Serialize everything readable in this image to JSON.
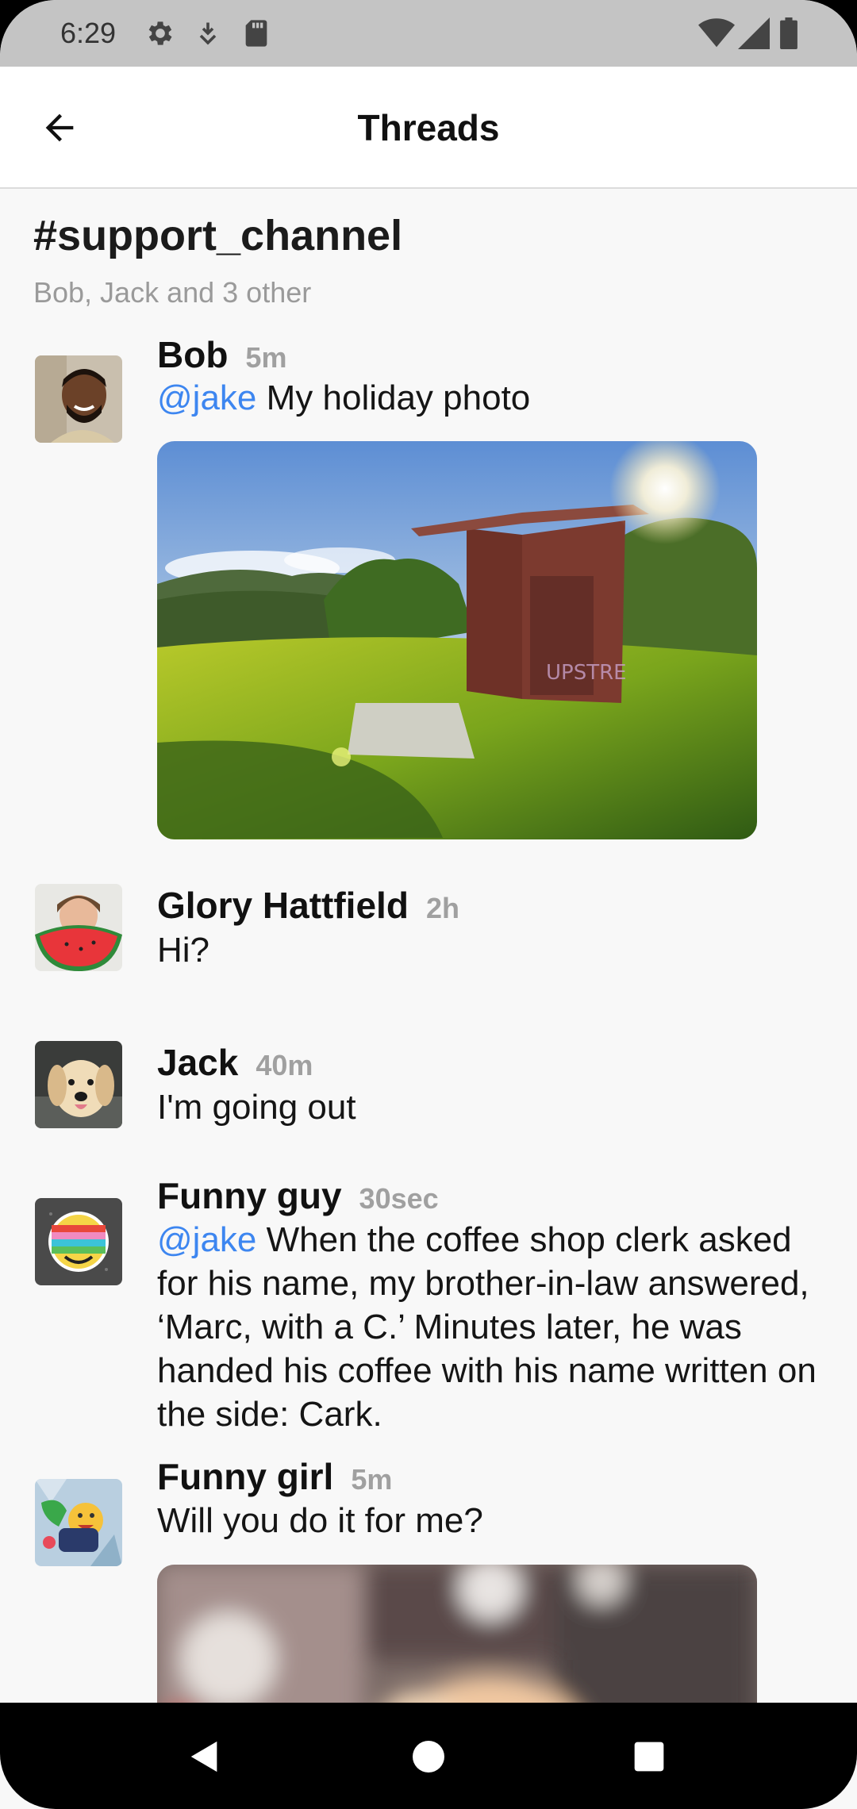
{
  "status_bar": {
    "time": "6:29",
    "icons": [
      "settings-icon",
      "download-icon",
      "sd-card-icon",
      "wifi-icon",
      "signal-icon",
      "battery-icon"
    ]
  },
  "app_bar": {
    "title": "Threads",
    "back_icon": "arrow-back-icon"
  },
  "channel": {
    "name": "#support_channel",
    "members": "Bob, Jack and 3 other"
  },
  "messages": [
    {
      "author": "Bob",
      "time": "5m",
      "mention": "@jake",
      "text": "My holiday photo",
      "has_image": true
    },
    {
      "author": "Glory Hattfield",
      "time": "2h",
      "text": "Hi?"
    },
    {
      "author": "Jack",
      "time": "40m",
      "text": "I'm going out"
    },
    {
      "author": "Funny guy",
      "time": "30sec",
      "mention": "@jake",
      "text": "When the coffee shop clerk asked for his name, my brother-in-law answered, ‘Marc, with a C.’ Minutes later, he was handed his coffee with his name written on the side: Cark."
    },
    {
      "author": "Funny girl",
      "time": "5m",
      "text": "Will you do it for me?",
      "has_image": true
    }
  ],
  "colors": {
    "mention": "#3d86f0",
    "background": "#f8f8f8",
    "status_bar": "#c4c4c4"
  },
  "nav_bar": {
    "icons": [
      "back-triangle-icon",
      "home-circle-icon",
      "recents-square-icon"
    ]
  }
}
